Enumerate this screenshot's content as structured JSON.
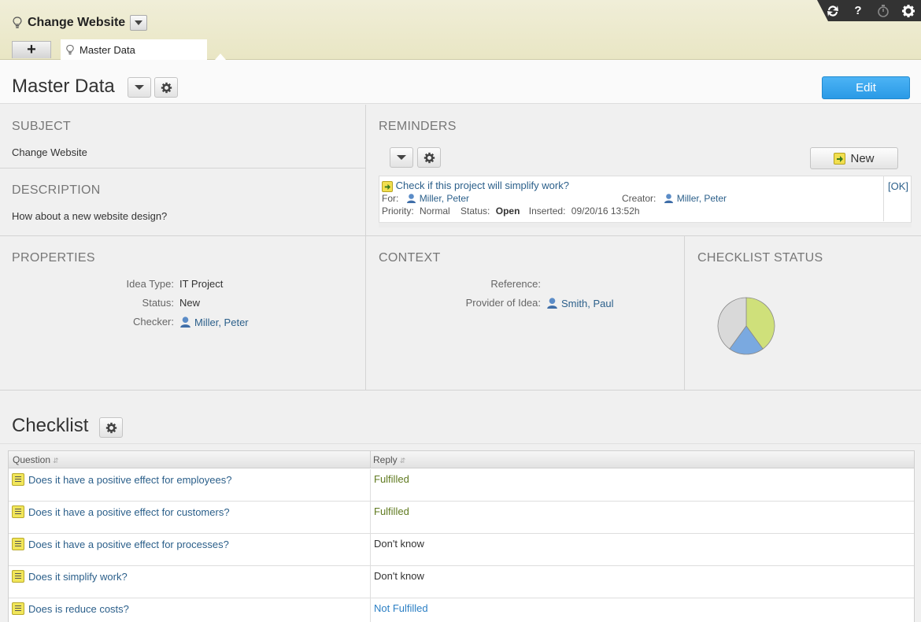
{
  "app": {
    "title": "Change Website"
  },
  "tabs": [
    {
      "label": "Master Data"
    }
  ],
  "toolbar": {
    "icons": [
      "refresh-icon",
      "help-icon",
      "timer-icon",
      "gear-icon"
    ],
    "help_label": "?"
  },
  "page": {
    "title": "Master Data",
    "edit_label": "Edit"
  },
  "subject": {
    "heading": "SUBJECT",
    "value": "Change Website"
  },
  "description": {
    "heading": "DESCRIPTION",
    "value": "How about a new website design?"
  },
  "reminders": {
    "heading": "REMINDERS",
    "new_label": "New",
    "items": [
      {
        "title": "Check if this project will simplify work?",
        "for_label": "For:",
        "for": "Miller, Peter",
        "creator_label": "Creator:",
        "creator": "Miller, Peter",
        "priority_label": "Priority:",
        "priority": "Normal",
        "status_label": "Status:",
        "status": "Open",
        "inserted_label": "Inserted:",
        "inserted": "09/20/16 13:52h",
        "ok_label": "[OK]"
      }
    ]
  },
  "properties": {
    "heading": "PROPERTIES",
    "rows": [
      {
        "label": "Idea Type:",
        "value": "IT Project"
      },
      {
        "label": "Status:",
        "value": "New"
      },
      {
        "label": "Checker:",
        "value": "Miller, Peter"
      }
    ]
  },
  "context": {
    "heading": "CONTEXT",
    "rows": [
      {
        "label": "Reference:",
        "value": ""
      },
      {
        "label": "Provider of Idea:",
        "value": "Smith, Paul"
      }
    ]
  },
  "checklist_status": {
    "heading": "CHECKLIST STATUS",
    "colors": {
      "fulfilled": "#cfe07a",
      "not_fulfilled": "#7aa9e0",
      "dont_know": "#d9d9d9"
    }
  },
  "chart_data": {
    "type": "pie",
    "categories": [
      "Fulfilled",
      "Not Fulfilled",
      "Don't know"
    ],
    "values": [
      2,
      1,
      2
    ]
  },
  "checklist": {
    "title": "Checklist",
    "columns": [
      "Question",
      "Reply"
    ],
    "rows": [
      {
        "question": "Does it have a positive effect for employees?",
        "reply": "Fulfilled",
        "reply_color": "#5f7a1f"
      },
      {
        "question": "Does it have a positive effect for customers?",
        "reply": "Fulfilled",
        "reply_color": "#5f7a1f"
      },
      {
        "question": "Does it have a positive effect for processes?",
        "reply": "Don't know",
        "reply_color": "#333333"
      },
      {
        "question": "Does it simplify work?",
        "reply": "Don't know",
        "reply_color": "#333333"
      },
      {
        "question": "Does is reduce costs?",
        "reply": "Not Fulfilled",
        "reply_color": "#2b7fc4"
      }
    ]
  }
}
